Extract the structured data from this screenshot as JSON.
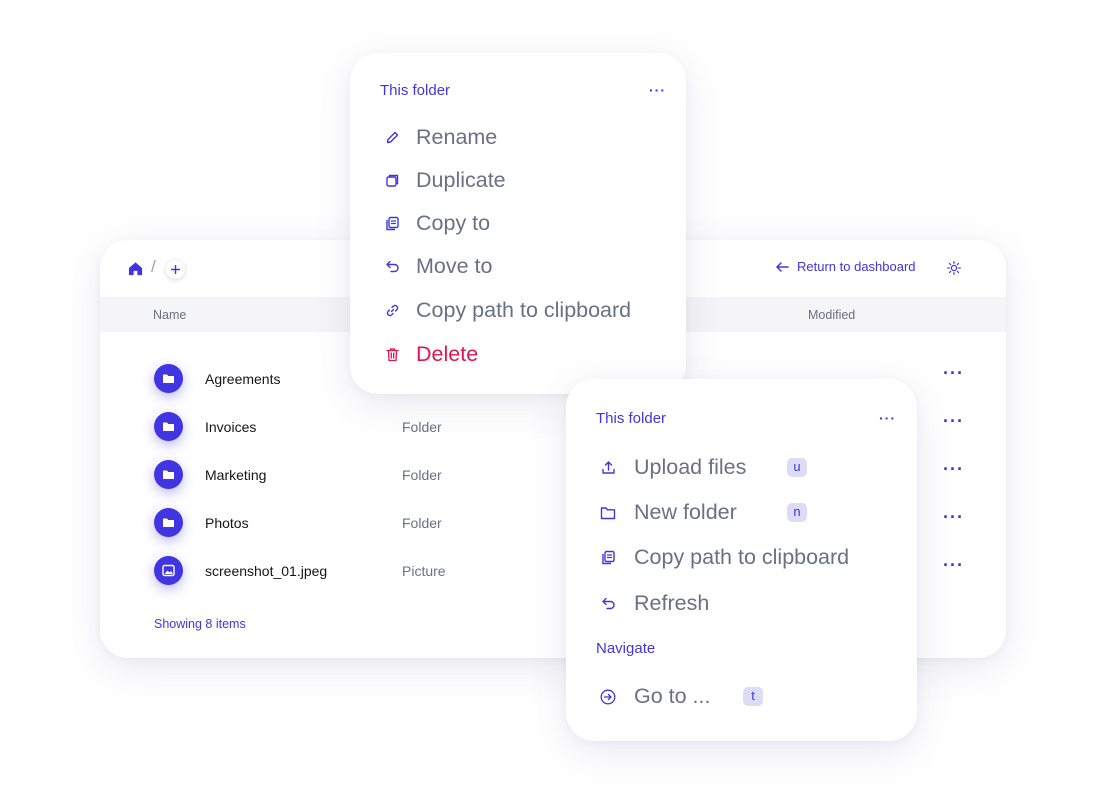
{
  "browser": {
    "breadcrumb_separator": "/",
    "return_label": "Return to dashboard",
    "columns": {
      "name": "Name",
      "modified": "Modified"
    },
    "rows": [
      {
        "name": "Agreements",
        "type": ""
      },
      {
        "name": "Invoices",
        "type": "Folder"
      },
      {
        "name": "Marketing",
        "type": "Folder"
      },
      {
        "name": "Photos",
        "type": "Folder"
      },
      {
        "name": "screenshot_01.jpeg",
        "type": "Picture"
      }
    ],
    "row_more": "···",
    "footer": "Showing 8 items"
  },
  "folder_menu": {
    "title": "This folder",
    "more": "···",
    "items": [
      {
        "label": "Rename",
        "icon": "pencil-icon"
      },
      {
        "label": "Duplicate",
        "icon": "duplicate-icon"
      },
      {
        "label": "Copy to",
        "icon": "copy-icon"
      },
      {
        "label": "Move to",
        "icon": "undo-arrow-icon"
      },
      {
        "label": "Copy path to clipboard",
        "icon": "link-icon"
      },
      {
        "label": "Delete",
        "icon": "trash-icon"
      }
    ]
  },
  "context_menu": {
    "title": "This folder",
    "more": "···",
    "items": [
      {
        "label": "Upload files",
        "shortcut": "u",
        "icon": "upload-icon"
      },
      {
        "label": "New folder",
        "shortcut": "n",
        "icon": "folder-icon"
      },
      {
        "label": "Copy path to clipboard",
        "icon": "copy-icon"
      },
      {
        "label": "Refresh",
        "icon": "undo-arrow-icon"
      }
    ],
    "navigate_title": "Navigate",
    "nav_items": [
      {
        "label": "Go to ...",
        "shortcut": "t",
        "icon": "arrow-circle-right-icon"
      }
    ]
  },
  "colors": {
    "accent": "#4035e0",
    "danger": "#e0144f",
    "muted": "#6b7083",
    "header_bg": "#f5f5f7"
  }
}
